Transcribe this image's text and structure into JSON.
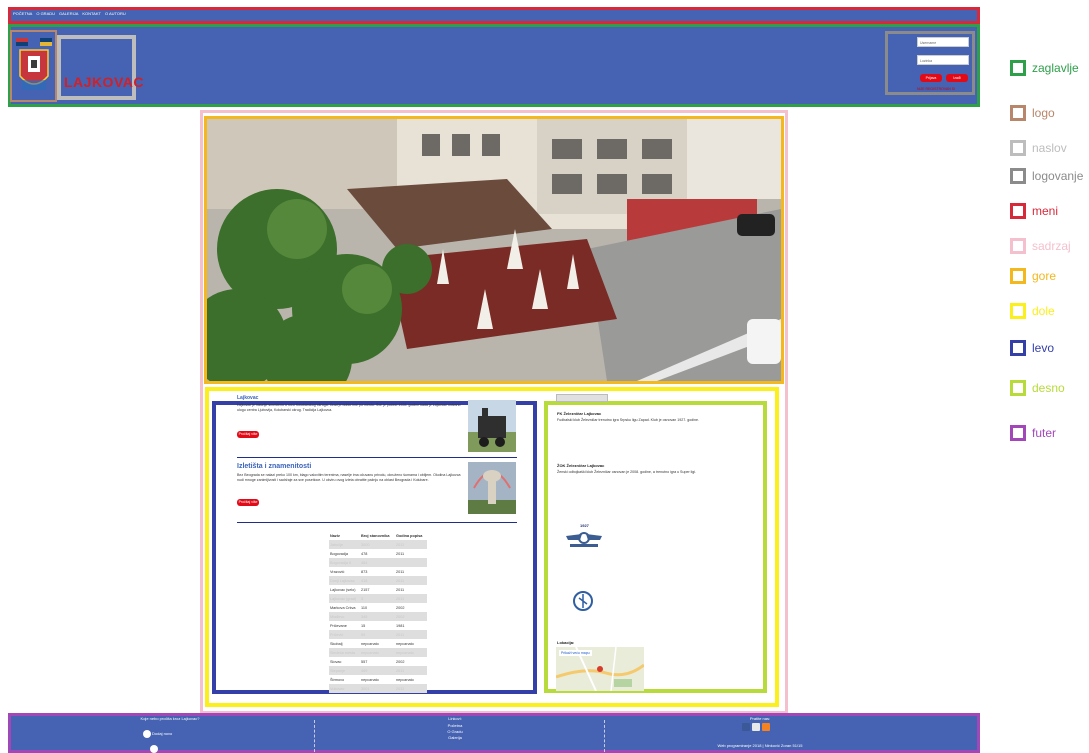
{
  "menu": {
    "items": [
      "POČETNA",
      "O GRADU",
      "GALERIJA",
      "KONTAKT",
      "O AUTORU"
    ]
  },
  "header": {
    "title": "LAJKOVAC"
  },
  "login": {
    "username_placeholder": "Username",
    "password_placeholder": "Lozinka",
    "login_label": "Prijava",
    "register_label": "Izađi",
    "register_link": "NIJE REGISTROVAN SI"
  },
  "left": {
    "article1": {
      "title": "Lajkovac",
      "text": "Lajkovac je naselje smešteno u srcu Kolubarskog okruga. Grad je dobio ime po mestu. Sve je počelo 1928. godine kada je Lajkovac ostvario ulogu centra Ljubovija, Kolubarski okrug. Tradicija Lajkovca.",
      "button": "Pročitaj više"
    },
    "article2": {
      "title": "Izletišta i znamenitosti",
      "text": "Bez Beograda se nalazi preko 100 km, blago valovitim terenima, naselje ima očuvanu prirodu, okruženo šumama i obiljem. Okolina Lajkovca nudi mnoge zanimljivosti i sadržaje za sve posetioce. U okviru ovog izleta obratite pažnju na oblast Beograda i Kolubare.",
      "button": "Pročitaj više"
    },
    "table": {
      "headers": [
        "Naziv",
        "Broj stanovnika",
        "Godina popisa"
      ],
      "rows": [
        [
          "Jabučje",
          "3000",
          "2011"
        ],
        [
          "Bogovadja",
          "478",
          "2011"
        ],
        [
          "Bogovadja II",
          "484",
          ""
        ],
        [
          "Vrazović",
          "873",
          "2011"
        ],
        [
          "Donji Lajkovac",
          "418",
          "2011"
        ],
        [
          "Lajkovac (selo)",
          "2157",
          "2011"
        ],
        [
          "Lajkovac (grad)",
          "3",
          "2011"
        ],
        [
          "Markova Crkva",
          "110",
          "2002"
        ],
        [
          "Mlađevo",
          "345",
          "2002"
        ],
        [
          "Pričevane",
          "15",
          "1981"
        ],
        [
          "Pričević",
          "59",
          "2011"
        ],
        [
          "Skobalj",
          "nepoznato",
          "nepoznato"
        ],
        [
          "Sledeća mesta",
          "nepoznato",
          "nepoznato"
        ],
        [
          "Slovac",
          "557",
          "2002"
        ],
        [
          "Stepanje",
          "469",
          "2011"
        ],
        [
          "Štrmovo",
          "nepoznato",
          "nepoznato"
        ],
        [
          "Vukovac",
          "3001",
          "2011"
        ]
      ]
    }
  },
  "right": {
    "item1_title": "FK Železničar Lajkovac",
    "item1_text": "Fudbalski klub Železničar trenutno igra Srpsku ligu Zapad. Klub je osnovan 1927. godine.",
    "item2_title": "ŽOK Železničar Lajkovac",
    "item2_text": "Ženski odbojkaški klub Železničar osnovan je 2008. godine, a trenutno igra u Super ligi.",
    "emblem_year": "1927",
    "location_title": "Lokacija:",
    "map_button": "Prikaži veću mapu"
  },
  "legend": [
    {
      "label": "zaglavlje",
      "color": "#2ea04a"
    },
    {
      "label": "logo",
      "color": "#b8866a"
    },
    {
      "label": "naslov",
      "color": "#bdbdbd"
    },
    {
      "label": "logovanje",
      "color": "#8b8b8b"
    },
    {
      "label": "meni",
      "color": "#d62a3b"
    },
    {
      "label": "sadrzaj",
      "color": "#f4c0ce"
    },
    {
      "label": "gore",
      "color": "#f2b81e"
    },
    {
      "label": "dole",
      "color": "#fbef1c"
    },
    {
      "label": "levo",
      "color": "#343fa8"
    },
    {
      "label": "desno",
      "color": "#b7db3b"
    },
    {
      "label": "futer",
      "color": "#a247b8"
    }
  ],
  "footer": {
    "poll_title": "Koje nebo pročita kroz Lajkovac?",
    "poll_option": "Dodaj novo",
    "links_title": "Linkovi:",
    "links": [
      "Početna",
      "O Gradu",
      "Galerija"
    ],
    "follow_title": "Pratite nas:",
    "copyright": "Web programiranje 2018 | Ninković Zoran 51/15"
  }
}
